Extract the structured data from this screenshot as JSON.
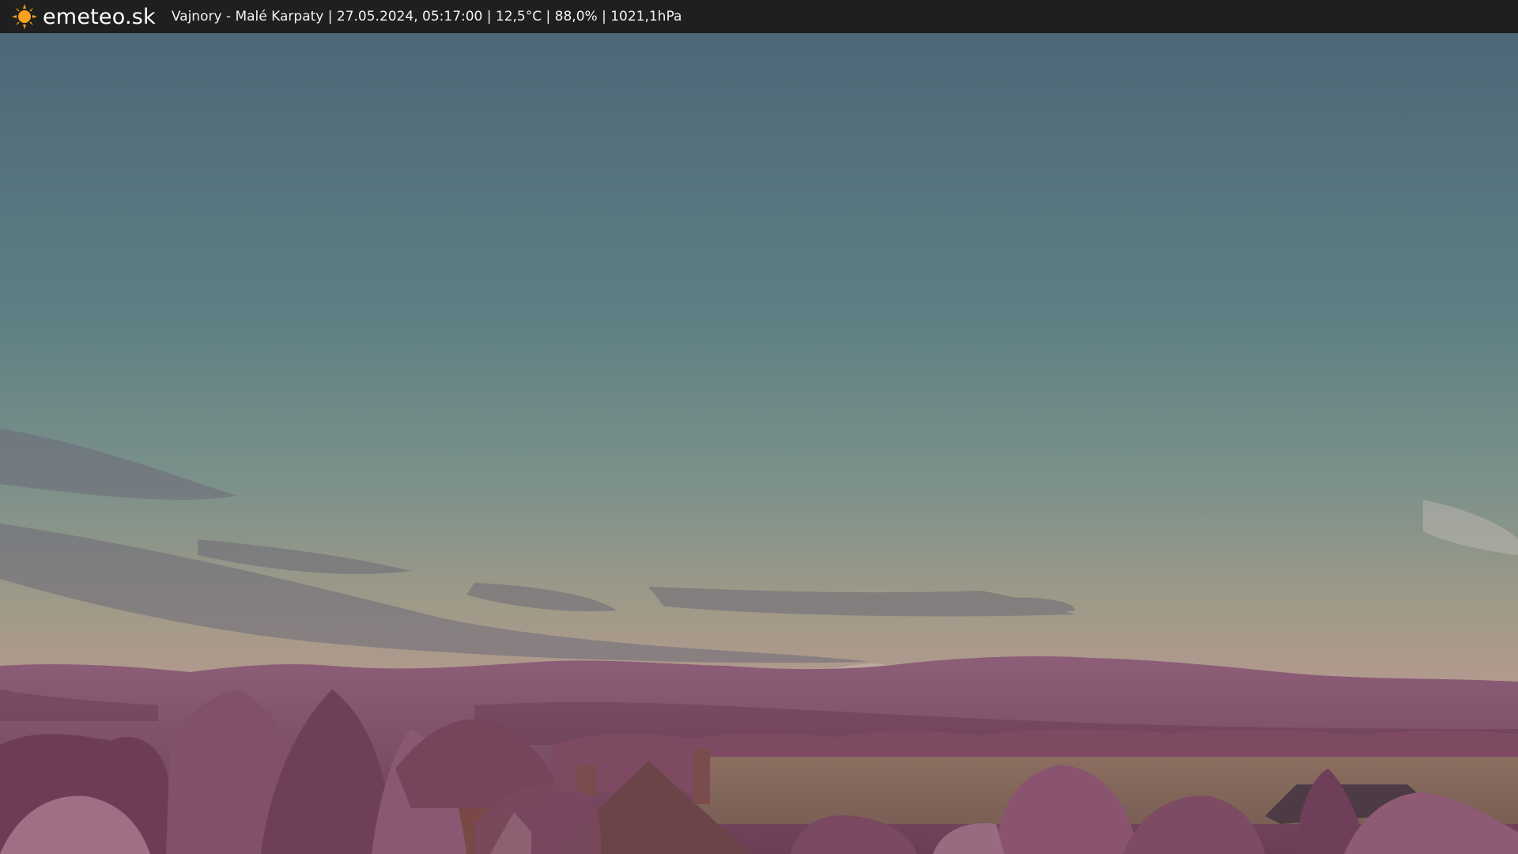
{
  "header": {
    "brand": "emeteo.sk",
    "logo_icon": "sun-icon",
    "caption": "Vajnory - Malé Karpaty | 27.05.2024, 05:17:00 | 12,5°C | 88,0% | 1021,1hPa"
  },
  "colors": {
    "bar_background": "#1f1f1f",
    "sun": "#f6a21c",
    "sky_top": "#506c7c",
    "sky_mid": "#6e8c8e",
    "sky_horizon": "#b39b8c",
    "hills": "#8a5a72",
    "trees": "#7a4a5e"
  }
}
